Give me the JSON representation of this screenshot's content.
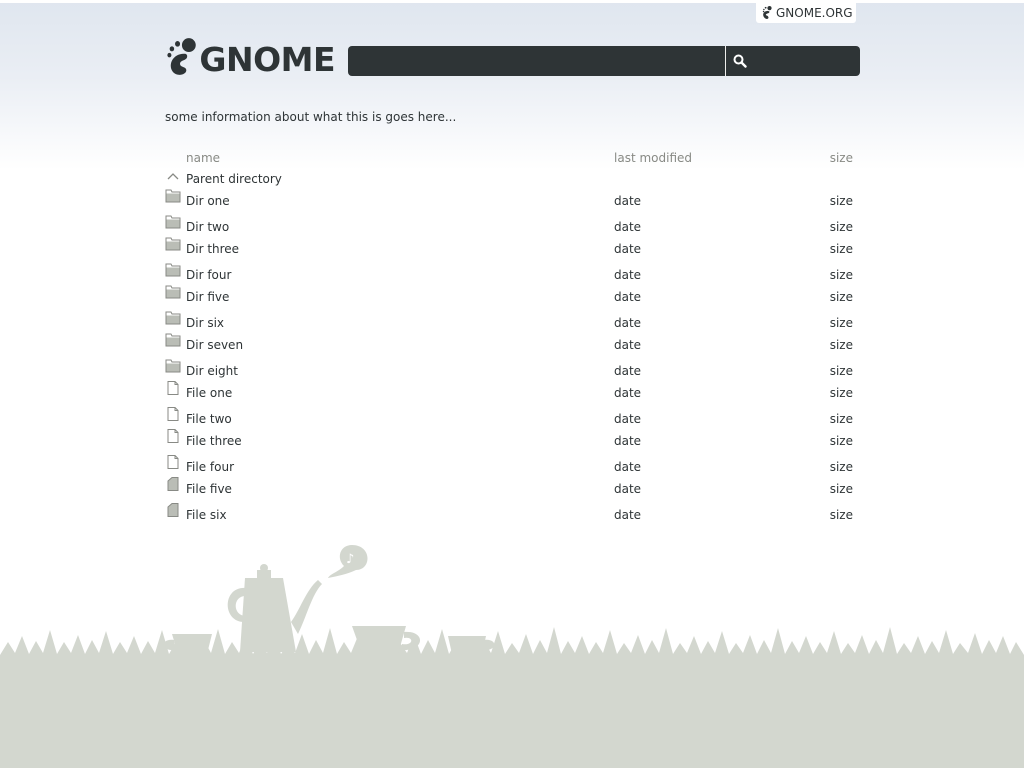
{
  "header": {
    "org_link": "GNOME.ORG",
    "logo_text": "GNOME",
    "search": {
      "value": "",
      "placeholder": ""
    }
  },
  "info_text": "some information about what this is goes here...",
  "listing": {
    "columns": {
      "name": "name",
      "modified": "last modified",
      "size": "size"
    },
    "parent_label": "Parent directory",
    "entries": [
      {
        "name": "Dir one",
        "date": "date",
        "size": "size",
        "icon": "folder-icon"
      },
      {
        "name": "Dir two",
        "date": "date",
        "size": "size",
        "icon": "folder-icon"
      },
      {
        "name": "Dir three",
        "date": "date",
        "size": "size",
        "icon": "folder-icon"
      },
      {
        "name": "Dir four",
        "date": "date",
        "size": "size",
        "icon": "folder-icon"
      },
      {
        "name": "Dir five",
        "date": "date",
        "size": "size",
        "icon": "folder-icon"
      },
      {
        "name": "Dir six",
        "date": "date",
        "size": "size",
        "icon": "folder-icon"
      },
      {
        "name": "Dir seven",
        "date": "date",
        "size": "size",
        "icon": "folder-icon"
      },
      {
        "name": "Dir eight",
        "date": "date",
        "size": "size",
        "icon": "folder-icon"
      },
      {
        "name": "File one",
        "date": "date",
        "size": "size",
        "icon": "file-icon"
      },
      {
        "name": "File two",
        "date": "date",
        "size": "size",
        "icon": "file-icon"
      },
      {
        "name": "File three",
        "date": "date",
        "size": "size",
        "icon": "file-icon"
      },
      {
        "name": "File four",
        "date": "date",
        "size": "size",
        "icon": "file-icon"
      },
      {
        "name": "File five",
        "date": "date",
        "size": "size",
        "icon": "file-filled-icon"
      },
      {
        "name": "File six",
        "date": "date",
        "size": "size",
        "icon": "file-filled-icon"
      }
    ]
  },
  "colors": {
    "dark": "#2e3436",
    "muted": "#888a85",
    "footer": "#d3d7cf",
    "top_gradient": "#dfe6ef"
  }
}
